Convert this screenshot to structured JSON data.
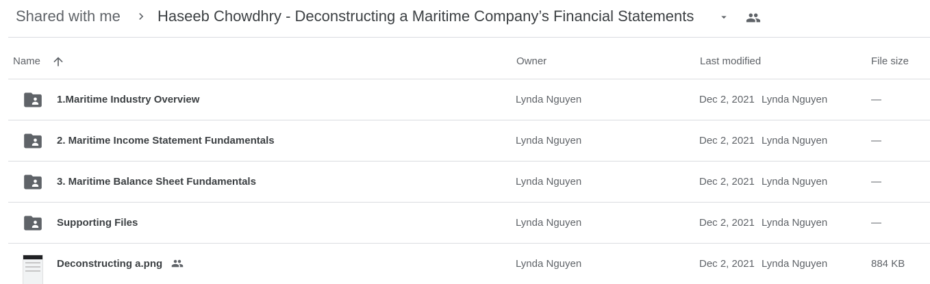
{
  "breadcrumb": {
    "root": "Shared with me",
    "current": "Haseeb Chowdhry - Deconstructing a Maritime Company’s Financial Statements"
  },
  "columns": {
    "name": "Name",
    "owner": "Owner",
    "last_modified": "Last modified",
    "file_size": "File size"
  },
  "files": [
    {
      "name": "1.Maritime Industry Overview",
      "type": "shared-folder",
      "owner": "Lynda Nguyen",
      "modified_date": "Dec 2, 2021",
      "modified_by": "Lynda Nguyen",
      "size": "—"
    },
    {
      "name": "2. Maritime Income Statement Fundamentals",
      "type": "shared-folder",
      "owner": "Lynda Nguyen",
      "modified_date": "Dec 2, 2021",
      "modified_by": "Lynda Nguyen",
      "size": "—"
    },
    {
      "name": "3. Maritime Balance Sheet Fundamentals",
      "type": "shared-folder",
      "owner": "Lynda Nguyen",
      "modified_date": "Dec 2, 2021",
      "modified_by": "Lynda Nguyen",
      "size": "—"
    },
    {
      "name": "Supporting Files",
      "type": "shared-folder",
      "owner": "Lynda Nguyen",
      "modified_date": "Dec 2, 2021",
      "modified_by": "Lynda Nguyen",
      "size": "—"
    },
    {
      "name": "Deconstructing a.png",
      "type": "image",
      "shared": true,
      "owner": "Lynda Nguyen",
      "modified_date": "Dec 2, 2021",
      "modified_by": "Lynda Nguyen",
      "size": "884 KB"
    }
  ],
  "colors": {
    "text_primary": "#3c4043",
    "text_secondary": "#5f6368",
    "divider": "#dadce0",
    "icon": "#5f6368"
  },
  "icons": {
    "separator": "chevron-right-icon",
    "dropdown": "arrow-drop-down-icon",
    "shared": "people-icon",
    "sort": "arrow-upward-icon",
    "folder": "shared-folder-icon",
    "image": "image-thumbnail-icon"
  }
}
